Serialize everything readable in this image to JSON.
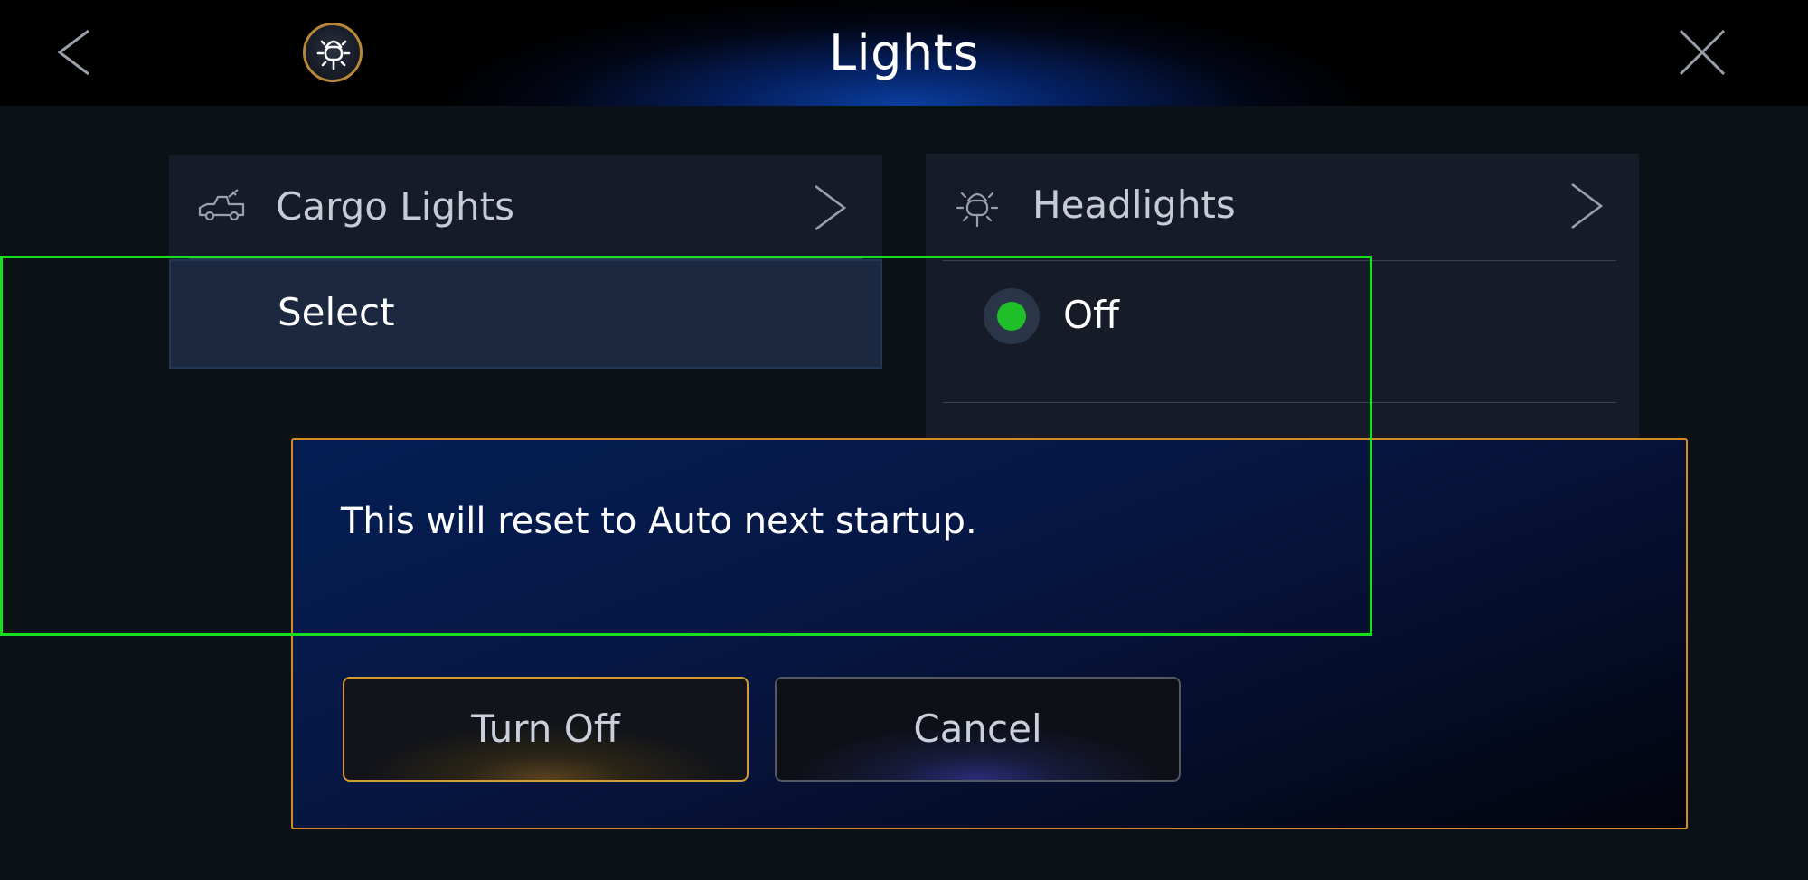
{
  "header": {
    "title": "Lights"
  },
  "cards": {
    "cargo": {
      "label": "Cargo Lights",
      "option": "Select"
    },
    "headlights": {
      "label": "Headlights",
      "option": "Off"
    }
  },
  "dialog": {
    "message": "This will reset to Auto next startup.",
    "confirm_label": "Turn Off",
    "cancel_label": "Cancel"
  },
  "colors": {
    "accent_orange": "#d48b22",
    "radio_selected": "#1fbf2a",
    "highlight_box": "#18e01e"
  },
  "icons": [
    "back-icon",
    "headlight-icon",
    "close-icon",
    "cargo-truck-icon",
    "chevron-right-icon"
  ]
}
